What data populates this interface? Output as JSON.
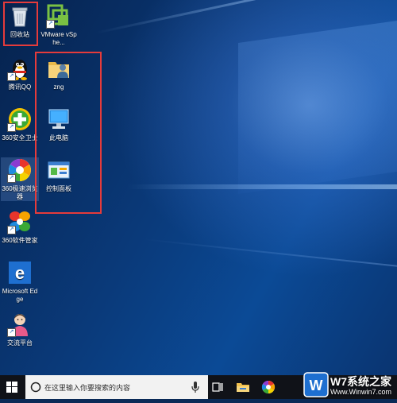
{
  "desktop": {
    "icons_left": [
      {
        "label": "回收站",
        "icon": "recycle-bin-icon"
      },
      {
        "label": "腾讯QQ",
        "icon": "qq-penguin-icon"
      },
      {
        "label": "360安全卫士",
        "icon": "360-security-icon"
      },
      {
        "label": "360极速浏览器",
        "icon": "360-browser-icon"
      },
      {
        "label": "360软件管家",
        "icon": "360-software-manager-icon"
      },
      {
        "label": "Microsoft Edge",
        "icon": "edge-icon"
      },
      {
        "label": "交流平台",
        "icon": "exchange-platform-icon"
      }
    ],
    "icons_right": [
      {
        "label": "VMware vSphe...",
        "icon": "vmware-vsphere-icon"
      },
      {
        "label": "zng",
        "icon": "user-folder-icon"
      },
      {
        "label": "此电脑",
        "icon": "this-pc-icon"
      },
      {
        "label": "控制面板",
        "icon": "control-panel-icon"
      }
    ]
  },
  "taskbar": {
    "search_placeholder": "在这里输入你要搜索的内容",
    "icons": [
      "windows-start-icon",
      "search-circle-icon",
      "microphone-icon",
      "task-view-icon",
      "file-explorer-icon",
      "360-browser-taskbar-icon"
    ]
  },
  "watermark": {
    "title": "W7系统之家",
    "url": "Www.Winwin7.com"
  },
  "colors": {
    "highlight": "#e53b3b",
    "taskbar": "#101218",
    "wallpaper": "#0a3a7a"
  }
}
